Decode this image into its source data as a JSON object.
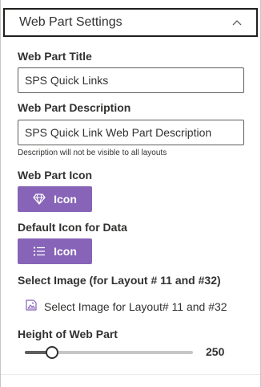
{
  "section": {
    "title": "Web Part Settings"
  },
  "title_field": {
    "label": "Web Part Title",
    "value": "SPS Quick Links"
  },
  "description_field": {
    "label": "Web Part Description",
    "value": "SPS Quick Link Web Part Description",
    "hint": "Description will not be visible to all layouts"
  },
  "web_part_icon": {
    "label": "Web Part Icon",
    "button_label": "Icon",
    "icon": "diamond-icon"
  },
  "default_icon": {
    "label": "Default Icon for Data",
    "button_label": "Icon",
    "icon": "list-icon"
  },
  "select_image": {
    "label": "Select Image (for Layout # 11 and #32)",
    "button_label": "Select Image for Layout# 11 and #32",
    "icon": "image-icon"
  },
  "height": {
    "label": "Height of Web Part",
    "value": "250",
    "slider_fraction": 0.16
  },
  "colors": {
    "accent": "#8764b8",
    "border": "#605e5c"
  }
}
